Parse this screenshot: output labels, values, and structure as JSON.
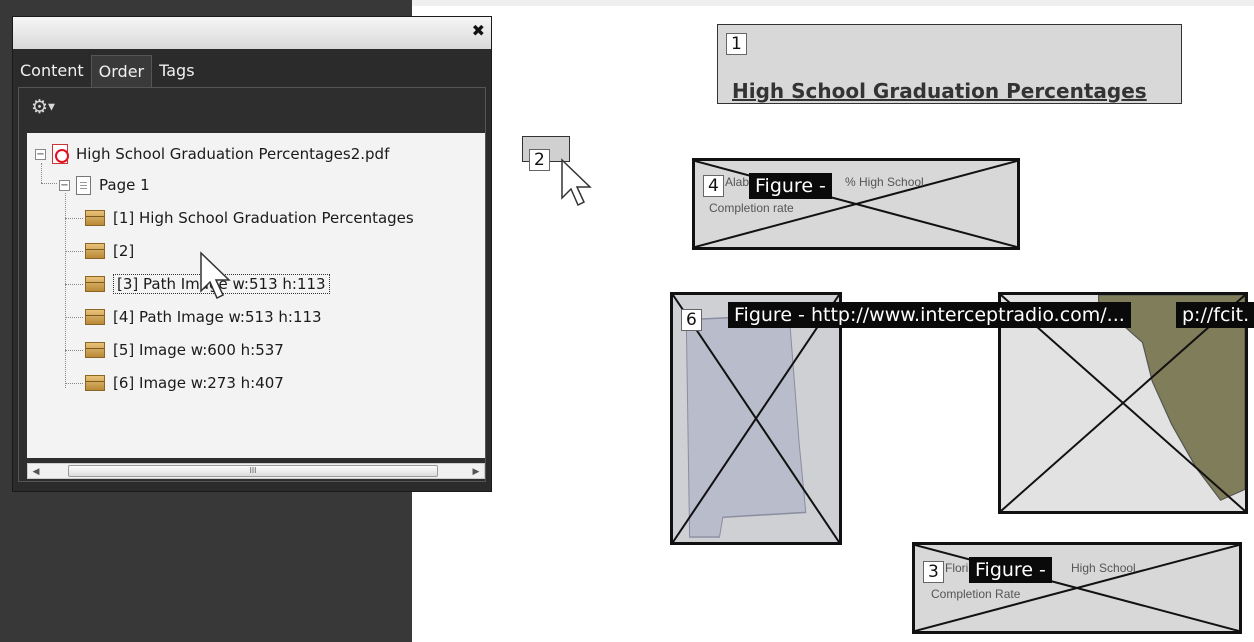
{
  "panel": {
    "close_glyph": "✖",
    "tabs": [
      "Content",
      "Order",
      "Tags"
    ],
    "active_tab": "Order",
    "gear_icon": "gear-icon",
    "tree": {
      "document": "High School Graduation Percentages2.pdf",
      "page": "Page 1",
      "items": [
        "[1]   High School Graduation Percentages",
        "[2]",
        "[3]  Path Image   w:513 h:113",
        "[4]  Path Image   w:513 h:113",
        "[5]  Image   w:600 h:537",
        "[6]  Image   w:273 h:407"
      ]
    },
    "scrollbar_thumb_glyph": "III"
  },
  "canvas": {
    "box1": {
      "number": "1",
      "title": "High School Graduation Percentages"
    },
    "box2": {
      "number": "2"
    },
    "box4": {
      "number": "4",
      "figure_label": "Figure -",
      "faint_text_1": "Alaba",
      "faint_text_2": "% High School",
      "faint_text_3": "Completion rate"
    },
    "box6": {
      "number": "6",
      "figure_label": "Figure - http://www.interceptradio.com/...",
      "figure_label_2": "p://fcit."
    },
    "box3": {
      "number": "3",
      "figure_label": "Figure -",
      "faint_text_1": "Flori",
      "faint_text_2": "High School",
      "faint_text_3": "Completion Rate"
    }
  },
  "colors": {
    "panel_dark": "#2b2b2b",
    "tree_bg": "#f3f3f3",
    "figure_tooltip_bg": "#0a0a0a"
  }
}
